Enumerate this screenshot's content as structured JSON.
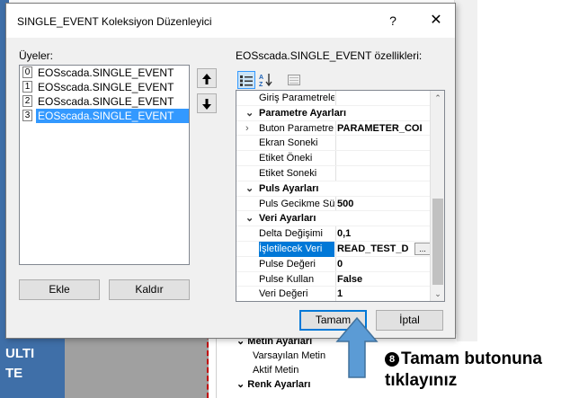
{
  "background": {
    "multi_label_line1": "ULTI",
    "multi_label_line2": "TE",
    "props": [
      {
        "label": "Metin Ayarları",
        "category": true
      },
      {
        "label": "Varsayılan Metin",
        "category": false
      },
      {
        "label": "Aktif Metin",
        "category": false
      },
      {
        "label": "Renk Ayarları",
        "category": true
      }
    ]
  },
  "dialog": {
    "title": "SINGLE_EVENT Koleksiyon Düzenleyici",
    "help_glyph": "?",
    "close_glyph": "✕",
    "members_label": "Üyeler:",
    "members": [
      {
        "index": "0",
        "name": "EOSscada.SINGLE_EVENT",
        "selected": false
      },
      {
        "index": "1",
        "name": "EOSscada.SINGLE_EVENT",
        "selected": false
      },
      {
        "index": "2",
        "name": "EOSscada.SINGLE_EVENT",
        "selected": false
      },
      {
        "index": "3",
        "name": "EOSscada.SINGLE_EVENT",
        "selected": true
      }
    ],
    "move_up_icon": "arrow-up-icon",
    "move_down_icon": "arrow-down-icon",
    "add_label": "Ekle",
    "remove_label": "Kaldır",
    "properties_label": "EOSscada.SINGLE_EVENT özellikleri:",
    "toolbar": {
      "categorized_icon": "categorized-icon",
      "alphabetical_icon": "alphabetical-sort-icon",
      "property_pages_icon": "property-pages-icon"
    },
    "properties": [
      {
        "name": "Giriş Parametrele",
        "value": "",
        "type": "partial"
      },
      {
        "name": "Parametre Ayarları",
        "type": "category"
      },
      {
        "name": "Buton Parametre",
        "value": "PARAMETER_COI",
        "type": "expandable"
      },
      {
        "name": "Ekran Soneki",
        "value": "",
        "type": "prop"
      },
      {
        "name": "Etiket Öneki",
        "value": "",
        "type": "prop"
      },
      {
        "name": "Etiket Soneki",
        "value": "",
        "type": "prop"
      },
      {
        "name": "Puls Ayarları",
        "type": "category"
      },
      {
        "name": "Puls Gecikme Sü",
        "value": "500",
        "type": "prop"
      },
      {
        "name": "Veri Ayarları",
        "type": "category"
      },
      {
        "name": "Delta Değişimi",
        "value": "0,1",
        "type": "prop"
      },
      {
        "name": "İşletilecek Veri",
        "value": "READ_TEST_D",
        "type": "selected"
      },
      {
        "name": "Pulse Değeri",
        "value": "0",
        "type": "prop"
      },
      {
        "name": "Pulse Kullan",
        "value": "False",
        "type": "prop"
      },
      {
        "name": "Veri Değeri",
        "value": "1",
        "type": "prop"
      }
    ],
    "ok_label": "Tamam",
    "cancel_label": "İptal"
  },
  "annotation": {
    "step_number": "8",
    "line1": "Tamam butonuna",
    "line2": "tıklayınız",
    "arrow_color": "#5b9bd5"
  }
}
